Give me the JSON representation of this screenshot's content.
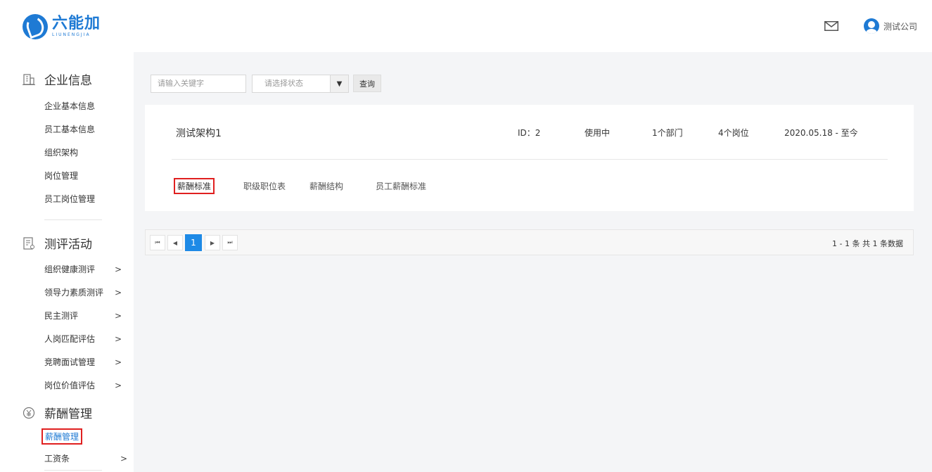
{
  "header": {
    "logo_cn": "六能加",
    "logo_en": "LIUNENGJIA",
    "user_name": "测试公司"
  },
  "sidebar": {
    "groups": [
      {
        "title": "企业信息",
        "icon": "building-icon",
        "items": [
          "企业基本信息",
          "员工基本信息",
          "组织架构",
          "岗位管理",
          "员工岗位管理"
        ]
      },
      {
        "title": "测评活动",
        "icon": "clipboard-icon",
        "items": [
          "组织健康测评",
          "领导力素质测评",
          "民主测评",
          "人岗匹配评估",
          "竞聘面试管理",
          "岗位价值评估"
        ]
      },
      {
        "title": "薪酬管理",
        "icon": "yen-icon",
        "items": [
          "薪酬管理",
          "工资条"
        ]
      }
    ],
    "chevron": ">"
  },
  "search": {
    "keyword_placeholder": "请输入关键字",
    "status_placeholder": "请选择状态",
    "query_label": "查询"
  },
  "card": {
    "title": "测试架构1",
    "id": "ID：2",
    "status": "使用中",
    "departments": "1个部门",
    "positions": "4个岗位",
    "date_range": "2020.05.18 - 至今",
    "tabs": [
      "薪酬标准",
      "职级职位表",
      "薪酬结构",
      "员工薪酬标准"
    ]
  },
  "pagination": {
    "first": "⏮",
    "prev": "◀",
    "current_page": "1",
    "next": "▶",
    "last": "⏭",
    "summary": "1 - 1 条  共 1 条数据"
  },
  "colors": {
    "accent": "#1e7ad4",
    "highlight": "#e02020"
  }
}
